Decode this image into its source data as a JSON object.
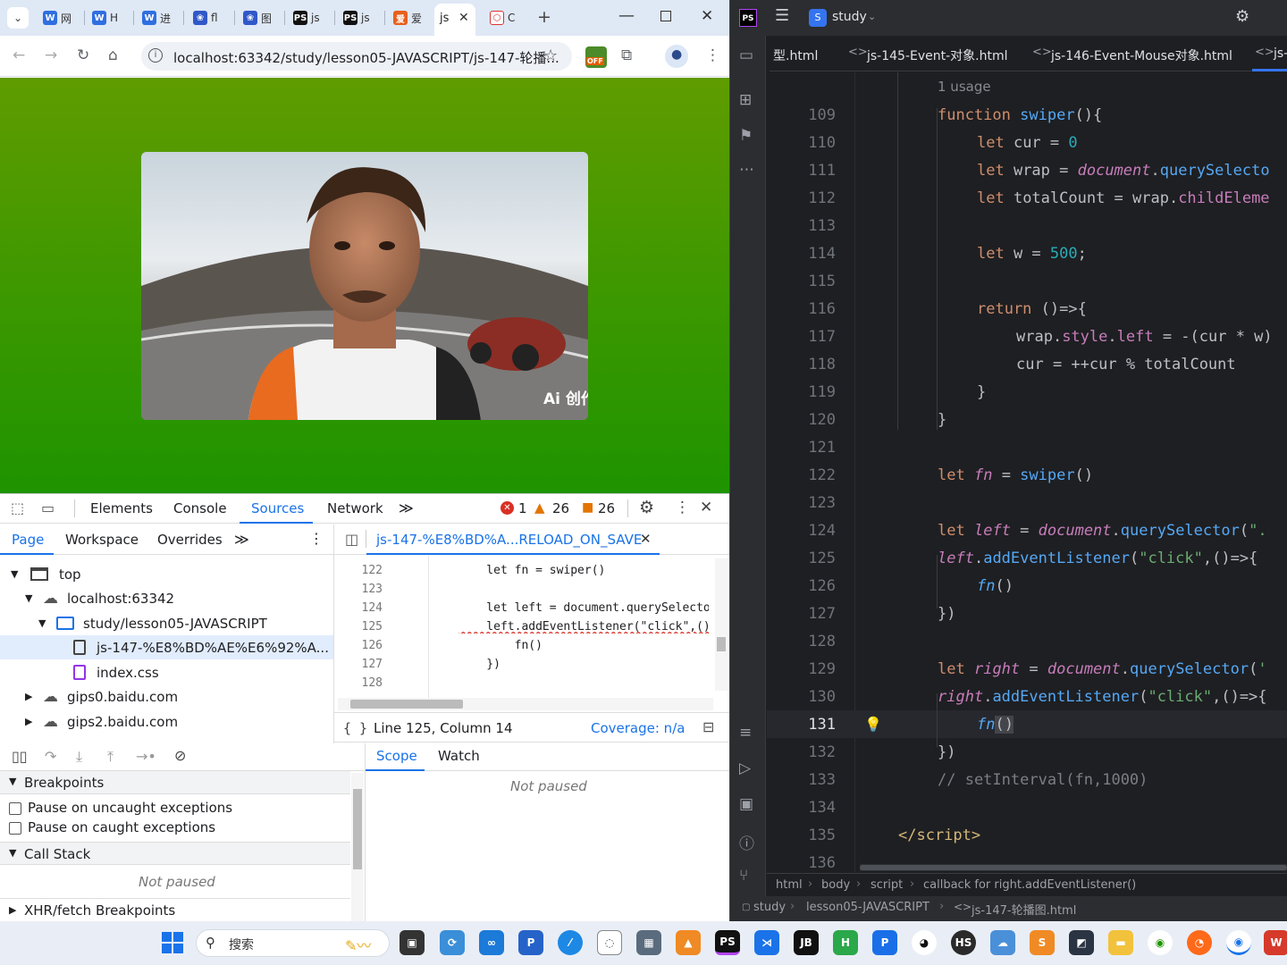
{
  "browser": {
    "tabs": [
      {
        "label": "网",
        "icon": "wps-icon"
      },
      {
        "label": "H",
        "icon": "wps-icon"
      },
      {
        "label": "进",
        "icon": "wps-icon"
      },
      {
        "label": "fl",
        "icon": "baidu-icon"
      },
      {
        "label": "图",
        "icon": "baidu-icon"
      },
      {
        "label": "js",
        "icon": "phpstorm-icon"
      },
      {
        "label": "js",
        "icon": "phpstorm-icon"
      },
      {
        "label": "爱",
        "icon": "aixin-icon"
      },
      {
        "label": "js",
        "icon": "js-icon"
      },
      {
        "label": "C",
        "icon": "codepen-icon"
      }
    ],
    "url": "localhost:63342/study/lesson05-JAVASCRIPT/js-147-轮播...",
    "ext_badge": "OFF",
    "photo_watermark": "Ai 创作"
  },
  "devtools": {
    "main_tabs": [
      "Elements",
      "Console",
      "Sources",
      "Network"
    ],
    "errors": "1",
    "warnings": "26",
    "issues": "26",
    "nav_tabs": [
      "Page",
      "Workspace",
      "Overrides"
    ],
    "file_tab": "js-147-%E8%BD%A...RELOAD_ON_SAVE",
    "tree": [
      "top",
      "localhost:63342",
      "study/lesson05-JAVASCRIPT",
      "js-147-%E8%BD%AE%E6%92%A...",
      "index.css",
      "gips0.baidu.com",
      "gips2.baidu.com"
    ],
    "code_lines": [
      {
        "n": "122",
        "t": "    let fn = swiper()"
      },
      {
        "n": "123",
        "t": ""
      },
      {
        "n": "124",
        "t": "    let left = document.querySelector(\"."
      },
      {
        "n": "125",
        "t": "    left.addEventListener(\"click\",()=>{"
      },
      {
        "n": "126",
        "t": "        fn()"
      },
      {
        "n": "127",
        "t": "    })"
      },
      {
        "n": "128",
        "t": ""
      }
    ],
    "position": "Line 125, Column 14",
    "coverage": "Coverage: n/a",
    "scope_tabs": [
      "Scope",
      "Watch"
    ],
    "not_paused": "Not paused",
    "breakpoints": "Breakpoints",
    "pause_uncaught": "Pause on uncaught exceptions",
    "pause_caught": "Pause on caught exceptions",
    "call_stack": "Call Stack",
    "xhr": "XHR/fetch Breakpoints"
  },
  "ide": {
    "project": "study",
    "project_initial": "S",
    "tabs": [
      "型.html",
      "js-145-Event-对象.html",
      "js-146-Event-Mouse对象.html",
      "js-"
    ],
    "usage_hint": "1 usage",
    "breadcrumb": [
      "html",
      "body",
      "script",
      "callback for right.addEventListener()"
    ],
    "statusbar": [
      "study",
      "lesson05-JAVASCRIPT",
      "js-147-轮播图.html"
    ],
    "line_numbers": [
      "109",
      "110",
      "111",
      "112",
      "113",
      "114",
      "115",
      "116",
      "117",
      "118",
      "119",
      "120",
      "121",
      "122",
      "123",
      "124",
      "125",
      "126",
      "127",
      "128",
      "129",
      "130",
      "131",
      "132",
      "133",
      "134",
      "135",
      "136"
    ]
  },
  "taskbar": {
    "search_placeholder": "搜索"
  }
}
